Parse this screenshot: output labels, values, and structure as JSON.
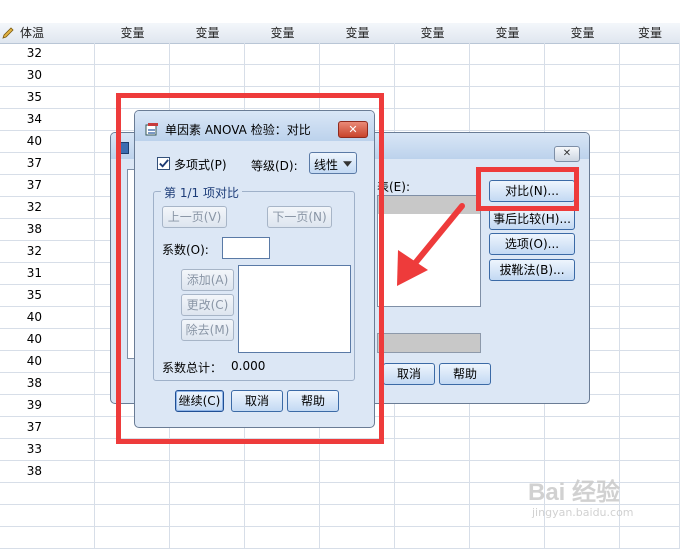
{
  "spreadsheet": {
    "first_column_header": "体温",
    "variable_header": "变量",
    "values": [
      "32",
      "30",
      "35",
      "34",
      "40",
      "37",
      "37",
      "32",
      "38",
      "32",
      "31",
      "35",
      "40",
      "40",
      "40",
      "38",
      "39",
      "37",
      "33",
      "38"
    ]
  },
  "back_dialog": {
    "dependent_label": "表(E):",
    "buttons": [
      "对比(N)...",
      "事后比较(H)...",
      "选项(O)...",
      "拔靴法(B)..."
    ],
    "cancel_label": "取消",
    "help_label": "帮助",
    "close_glyph": "✕"
  },
  "contrast_dialog": {
    "title": "单因素 ANOVA 检验：对比",
    "close_glyph": "✕",
    "polynomial_label": "多项式(P)",
    "polynomial_checked": true,
    "degree_label": "等级(D):",
    "degree_value": "线性",
    "group_title": "第 1/1 项对比",
    "prev_label": "上一页(V)",
    "next_label": "下一页(N)",
    "coef_label": "系数(O):",
    "coef_value": "",
    "add_label": "添加(A)",
    "change_label": "更改(C)",
    "remove_label": "除去(M)",
    "total_label": "系数总计：",
    "total_value": "0.000",
    "continue_label": "继续(C)",
    "cancel_label": "取消",
    "help_label": "帮助"
  },
  "watermark": {
    "brand": "Bai 经验",
    "url": "jingyan.baidu.com"
  },
  "colors": {
    "highlight_red": "#ee3b3b",
    "dialog_bg": "#dce7f5",
    "title_bg": "#bcd2ec"
  }
}
